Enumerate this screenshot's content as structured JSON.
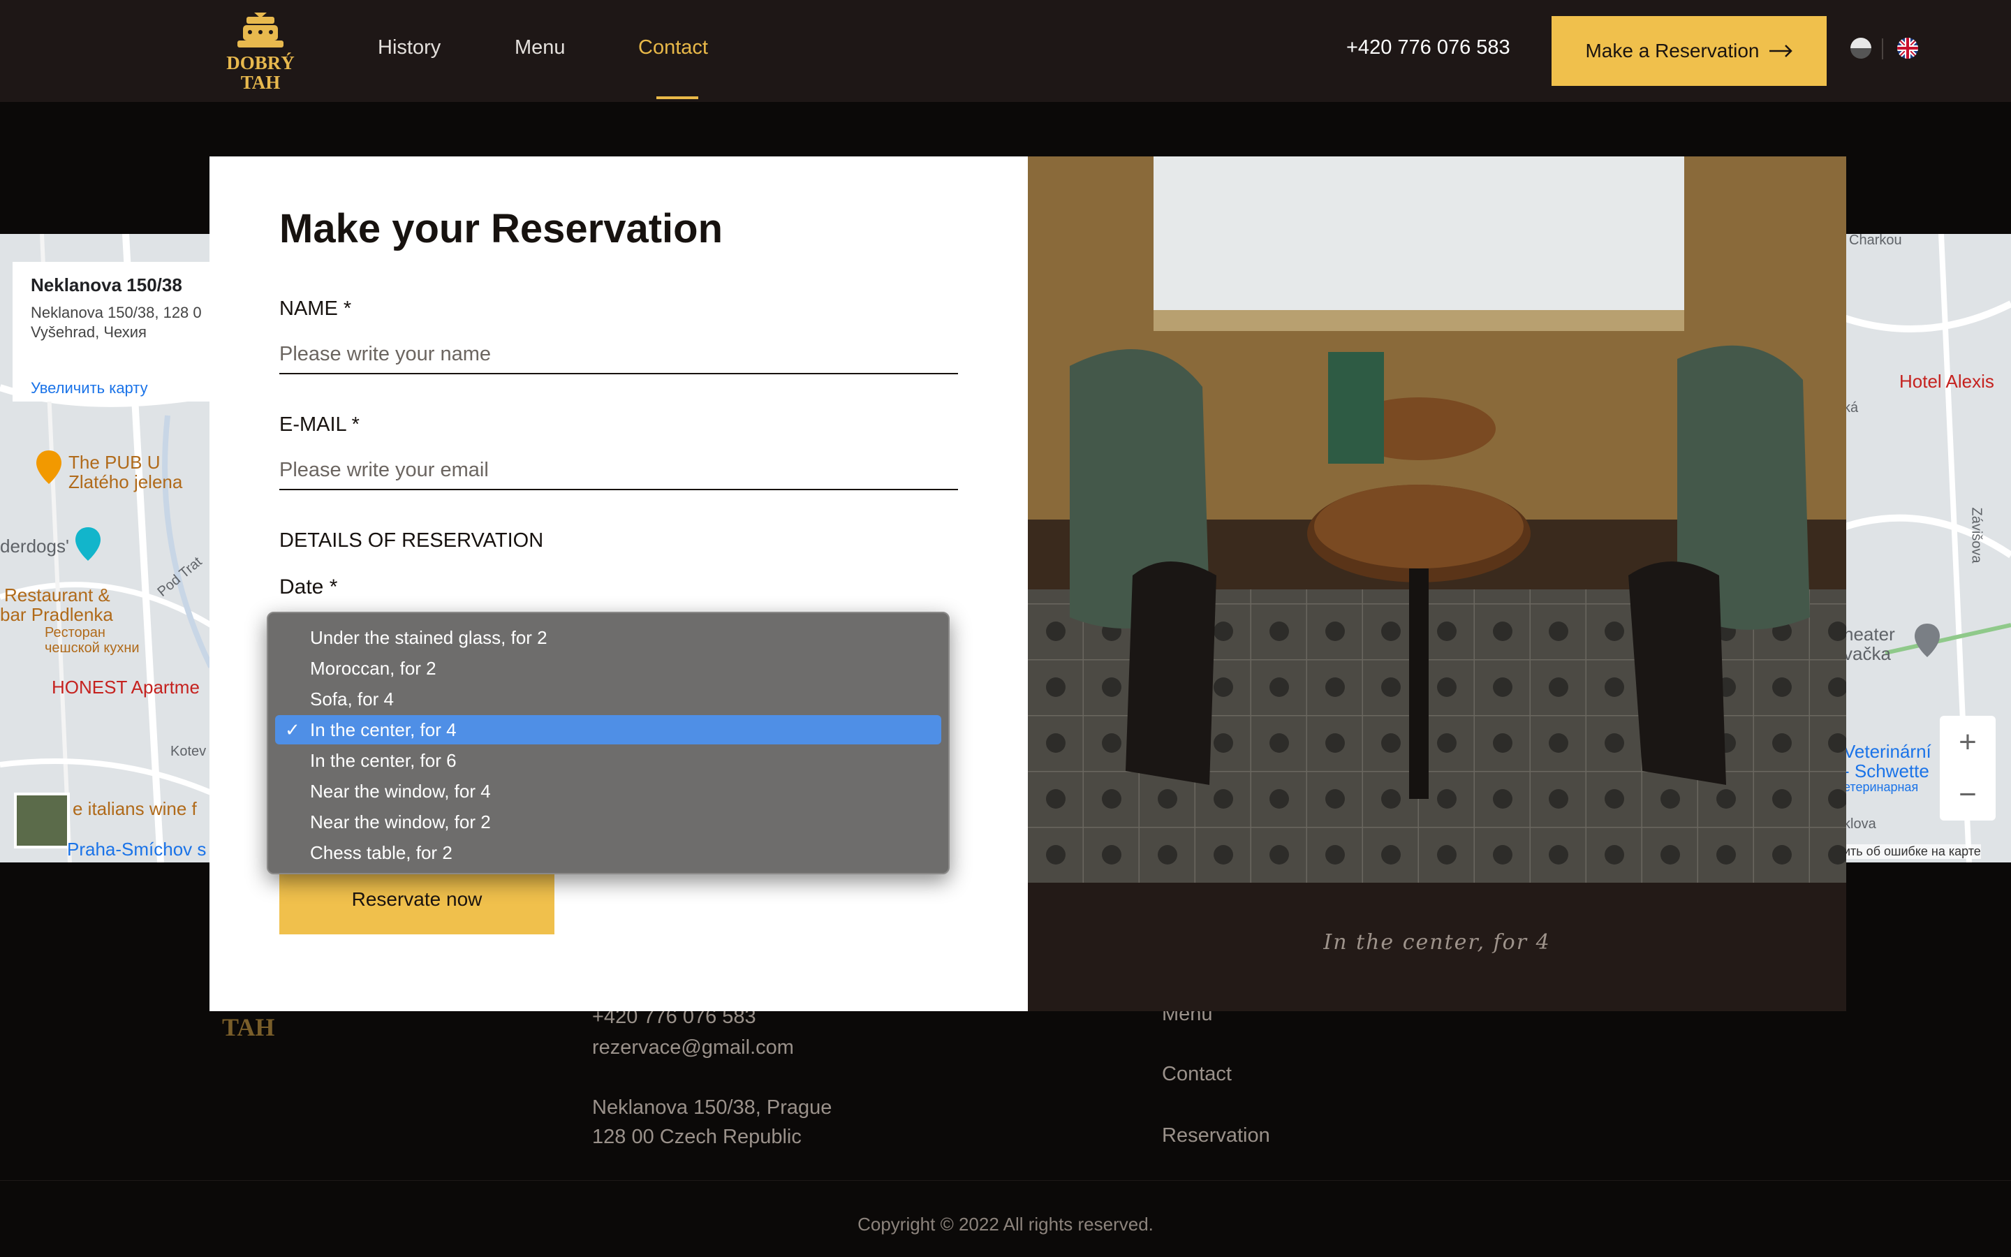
{
  "header": {
    "logo_line1": "DOBRÝ",
    "logo_line2": "TAH",
    "nav": [
      {
        "label": "History"
      },
      {
        "label": "Menu"
      },
      {
        "label": "Contact",
        "active": true
      }
    ],
    "phone": "+420 776 076 583",
    "cta_label": "Make a Reservation",
    "languages": [
      "cz",
      "en"
    ]
  },
  "map": {
    "card_title": "Neklanova 150/38",
    "card_address_line1": "Neklanova 150/38, 128 0",
    "card_address_line2": "Vyšehrad, Чехия",
    "card_link": "Увеличить карту",
    "poi": [
      "The PUB U",
      "Zlatého jelena",
      "derdogs'",
      "Restaurant &",
      "bar Pradlenka",
      "Ресторан",
      "чешской кухни",
      "HONEST Apartme",
      "Kotev",
      "Pod Trat",
      "e italians wine f",
      "Praha-Smíchov s"
    ],
    "poi_right": [
      "Charkou",
      "Hotel Alexis",
      "ká",
      "Závišova",
      "heater",
      "vačka",
      "Veterinární",
      "- Schwette",
      "етеринарная",
      "klova",
      "ить об ошибке на карте"
    ],
    "zoom_in": "+",
    "zoom_out": "−"
  },
  "footer": {
    "logo_line": "TAH",
    "phone": "+420 776 076 583",
    "email": "rezervace@gmail.com",
    "address_line1": "Neklanova 150/38, Prague",
    "address_line2": "128 00 Czech Republic",
    "links": [
      "Menu",
      "Contact",
      "Reservation"
    ],
    "copyright": "Copyright © 2022 All rights reserved."
  },
  "modal": {
    "title": "Make your Reservation",
    "name_label": "NAME *",
    "name_placeholder": "Please write your name",
    "email_label": "E-MAIL *",
    "email_placeholder": "Please write your email",
    "details_label": "DETAILS OF RESERVATION",
    "date_label": "Date *",
    "reserve_button": "Reservate now",
    "caption": "In the center, for 4"
  },
  "dropdown": {
    "options": [
      "Under the stained glass, for 2",
      "Moroccan, for 2",
      "Sofa, for 4",
      "In the center, for 4",
      "In the center, for 6",
      "Near the window, for 4",
      "Near the window, for 2",
      "Chess table, for 2"
    ],
    "selected": "In the center, for 4",
    "check_mark": "✓"
  },
  "colors": {
    "accent": "#f0c04c",
    "header_bg": "#1e1716",
    "page_bg": "#0b0908",
    "selection": "#4f8fe6"
  }
}
